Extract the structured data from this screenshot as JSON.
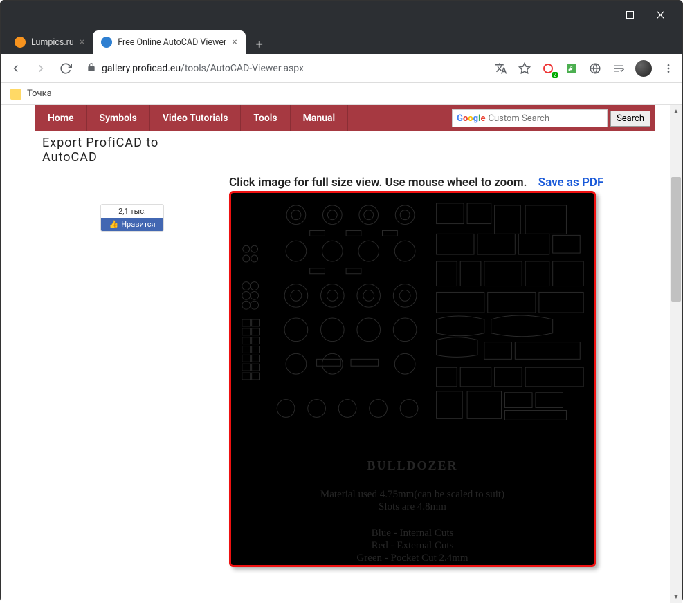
{
  "window": {
    "tabs": [
      {
        "title": "Lumpics.ru",
        "favicon_color": "#f7931e",
        "active": false
      },
      {
        "title": "Free Online AutoCAD Viewer",
        "favicon_color": "#2e7fd1",
        "active": true
      }
    ]
  },
  "url": {
    "host": "gallery.proficad.eu",
    "path": "/tools/AutoCAD-Viewer.aspx"
  },
  "toolbar": {
    "ext_badge": "2"
  },
  "bookmarks": [
    {
      "label": "Точка"
    }
  ],
  "nav": {
    "items": [
      "Home",
      "Symbols",
      "Video Tutorials",
      "Tools",
      "Manual"
    ],
    "search_placeholder": "Custom Search",
    "search_button": "Search"
  },
  "sidebar": {
    "heading_line1": "Export ProfiCAD to",
    "heading_line2": "AutoCAD",
    "fb_count": "2,1 тыс.",
    "fb_label": "Нравится"
  },
  "viewer": {
    "instruction_a": "Click image for full size view. Use mouse wheel to zoom.",
    "save_pdf": "Save as PDF",
    "drawing_title": "BULLDOZER",
    "drawing_lines": [
      "Material used 4.75mm(can be scaled to suit)",
      "Slots are 4.8mm",
      "Blue - Internal Cuts",
      "Red - External Cuts",
      "Green - Pocket Cut 2.4mm"
    ]
  }
}
